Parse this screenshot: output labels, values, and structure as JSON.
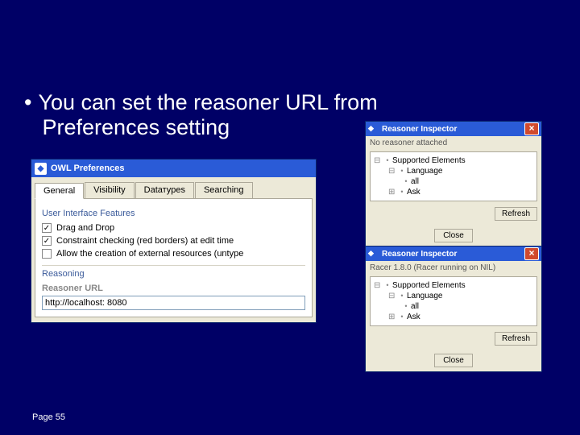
{
  "bullet_text_line1": "You can set the reasoner URL from",
  "bullet_text_line2": "Preferences setting",
  "page_label": "Page 55",
  "owl": {
    "title": "OWL Preferences",
    "tabs": {
      "general": "General",
      "visibility": "Visibility",
      "datatypes": "Datатypes",
      "searching": "Searching"
    },
    "ui_features": "User Interface Features",
    "drag_drop": "Drag and Drop",
    "constraint": "Constraint checking (red borders) at edit time",
    "allow_external": "Allow the creation of external resources (untype",
    "reasoning": "Reasoning",
    "url_label": "Reasoner URL",
    "url_value": "http://localhost: 8080"
  },
  "insp1": {
    "title": "Reasoner Inspector",
    "subtitle": "No reasoner attached",
    "root": "Supported Elements",
    "child1": "Language",
    "child2": "all",
    "child3": "Ask",
    "refresh": "Refresh",
    "close": "Close"
  },
  "insp2": {
    "title": "Reasoner Inspector",
    "subtitle": "Racer 1.8.0 (Racer running on NIL)",
    "root": "Supported Elements",
    "child1": "Language",
    "child2": "all",
    "child3": "Ask",
    "refresh": "Refresh",
    "close": "Close"
  }
}
